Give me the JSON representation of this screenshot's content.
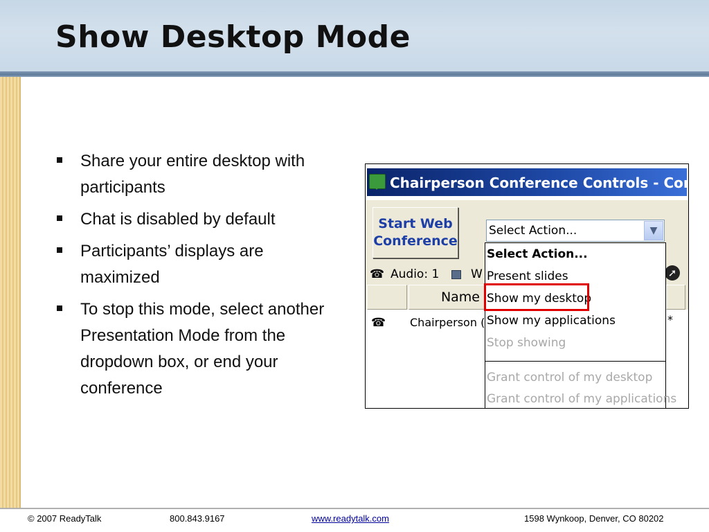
{
  "slide": {
    "title": "Show Desktop Mode",
    "bullets": [
      "Share your entire desktop with participants",
      "Chat is disabled by default",
      "Participants’ displays are maximized",
      "To stop this mode, select another Presentation Mode from the dropdown box, or end your conference"
    ]
  },
  "screenshot": {
    "window_title": "Chairperson Conference Controls - Confer",
    "start_button_label": "Start Web Conference",
    "select_value": "Select Action...",
    "audio_label": "Audio: 1",
    "web_label_partial": "W",
    "column_name_header": "Name",
    "row_name": "Chairperson (",
    "row_trailing_mark": "*",
    "dropdown_options": [
      {
        "label": "Select Action...",
        "style": "bold"
      },
      {
        "label": "Present slides",
        "style": "normal"
      },
      {
        "label": "Show my desktop",
        "style": "normal",
        "highlighted": true
      },
      {
        "label": "Show my applications",
        "style": "normal"
      },
      {
        "label": "Stop showing",
        "style": "disabled"
      },
      {
        "label": "Grant control of my desktop",
        "style": "disabled"
      },
      {
        "label": "Grant control of my applications",
        "style": "disabled"
      }
    ],
    "icons": [
      "app-chat-icon",
      "telephone-icon",
      "computer-icon",
      "chevron-down-icon",
      "arrow-icon"
    ]
  },
  "footer": {
    "copyright": "© 2007 ReadyTalk",
    "phone": "800.843.9167",
    "website": "www.readytalk.com",
    "address": "1598 Wynkoop, Denver, CO 80202"
  },
  "colors": {
    "title_bar_gradient_start": "#0a246a",
    "start_button_text": "#1d3fa6",
    "highlight_box": "#e00000",
    "left_stripe": "#e7c87f"
  }
}
